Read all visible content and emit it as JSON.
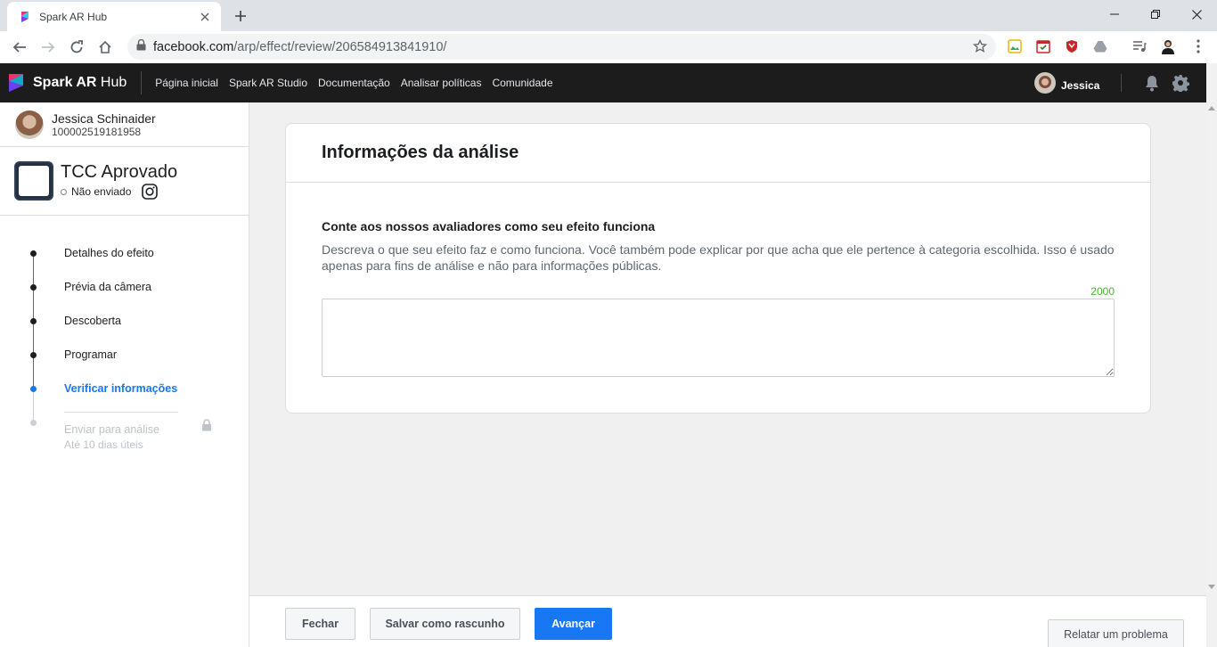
{
  "browser": {
    "tab_title": "Spark AR Hub",
    "url_host": "facebook.com",
    "url_path": "/arp/effect/review/206584913841910/"
  },
  "nav": {
    "brand_bold": "Spark AR",
    "brand_light": " Hub",
    "links": [
      "Página inicial",
      "Spark AR Studio",
      "Documentação",
      "Analisar políticas",
      "Comunidade"
    ],
    "user_name": "Jessica"
  },
  "sidebar": {
    "user_name": "Jessica Schinaider",
    "user_id": "100002519181958",
    "effect_title": "TCC Aprovado",
    "effect_status": "Não enviado",
    "steps": [
      {
        "label": "Detalhes do efeito",
        "state": "done"
      },
      {
        "label": "Prévia da câmera",
        "state": "done"
      },
      {
        "label": "Descoberta",
        "state": "done"
      },
      {
        "label": "Programar",
        "state": "done"
      },
      {
        "label": "Verificar informações",
        "state": "active"
      },
      {
        "label": "Enviar para análise",
        "sub": "Até 10 dias úteis",
        "state": "locked"
      }
    ]
  },
  "main": {
    "title": "Informações da análise",
    "section_title": "Conte aos nossos avaliadores como seu efeito funciona",
    "section_desc": "Descreva o que seu efeito faz e como funciona. Você também pode explicar por que acha que ele pertence à categoria escolhida. Isso é usado apenas para fins de análise e não para informações públicas.",
    "char_count": "2000",
    "textarea_value": ""
  },
  "footer": {
    "close_label": "Fechar",
    "save_draft_label": "Salvar como rascunho",
    "next_label": "Avançar",
    "report_label": "Relatar um problema"
  },
  "colors": {
    "accent": "#1877f2",
    "nav_bg": "#1c1c1c",
    "counter": "#42b72a"
  }
}
